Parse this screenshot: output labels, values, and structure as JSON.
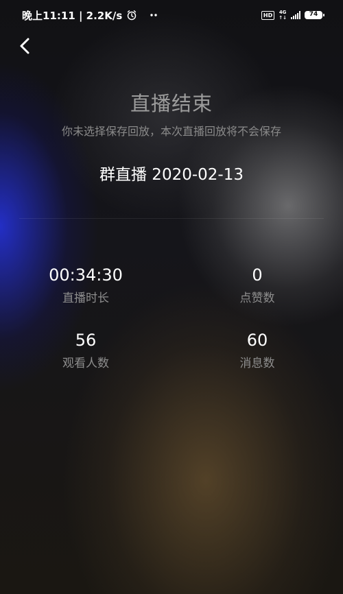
{
  "status_bar": {
    "time_text": "晚上11:11 | 2.2K/s",
    "hd": "HD",
    "network": "4G",
    "battery": "74"
  },
  "page": {
    "title": "直播结束",
    "subtitle": "你未选择保存回放，本次直播回放将不会保存",
    "live_name": "群直播 2020-02-13"
  },
  "stats": [
    {
      "value": "00:34:30",
      "label": "直播时长"
    },
    {
      "value": "0",
      "label": "点赞数"
    },
    {
      "value": "56",
      "label": "观看人数"
    },
    {
      "value": "60",
      "label": "消息数"
    }
  ],
  "icons": {
    "back": "chevron-left-icon",
    "alarm": "alarm-clock-icon",
    "more": "more-dots-icon",
    "signal": "signal-bars-icon",
    "battery": "battery-icon"
  },
  "colors": {
    "title": "#9c9c9c",
    "subtitle": "#8a8a8a",
    "value": "#ffffff",
    "label": "#8d8d8d"
  }
}
